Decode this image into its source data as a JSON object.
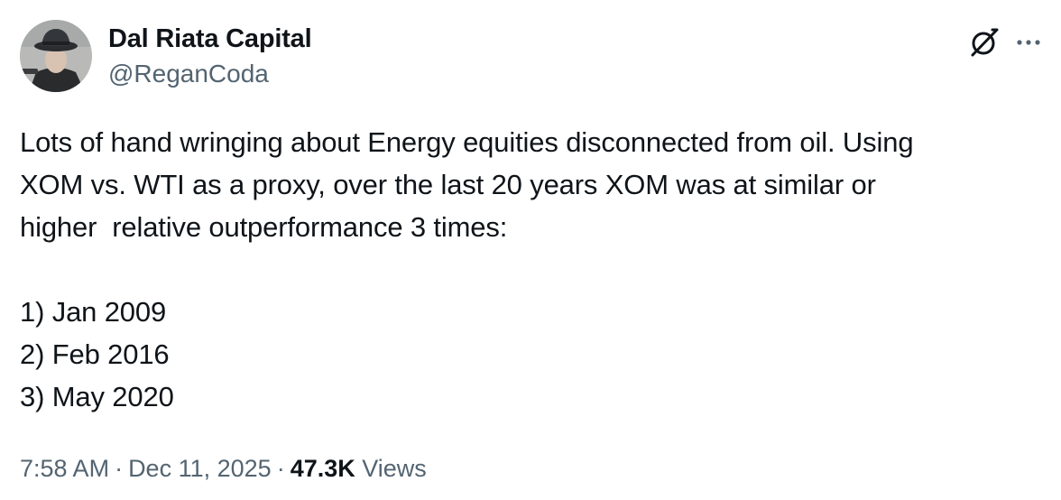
{
  "author": {
    "display_name": "Dal Riata Capital",
    "handle": "@ReganCoda"
  },
  "tweet": {
    "text": "Lots of hand wringing about Energy equities disconnected from oil. Using\nXOM vs. WTI as a proxy, over the last 20 years XOM was at similar or\nhigher  relative outperformance 3 times:\n\n1) Jan 2009\n2) Feb 2016\n3) May 2020"
  },
  "meta": {
    "time": "7:58 AM",
    "separator": "·",
    "date": "Dec 11, 2025",
    "views_count": "47.3K",
    "views_label": "Views"
  },
  "icons": {
    "grok": "grok-icon",
    "more": "more-icon",
    "avatar": "avatar"
  },
  "colors": {
    "text_primary": "#0f1419",
    "text_secondary": "#536471"
  }
}
